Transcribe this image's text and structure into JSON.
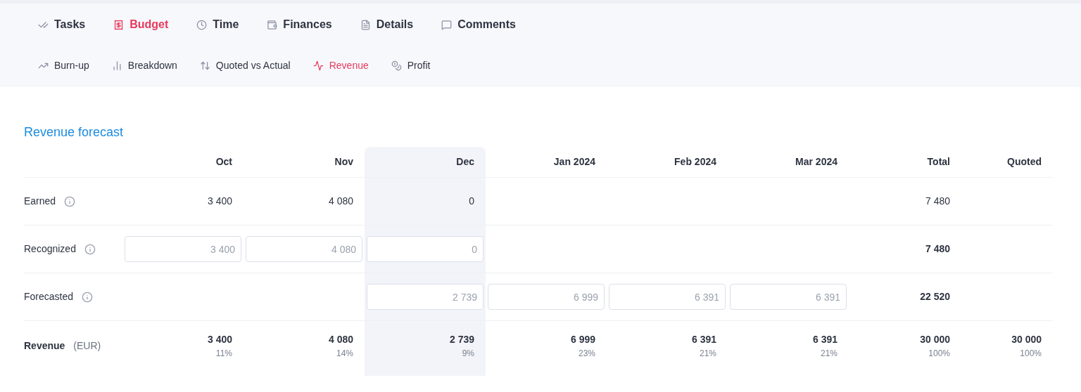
{
  "tabs": [
    {
      "label": "Tasks",
      "selected": false
    },
    {
      "label": "Budget",
      "selected": true
    },
    {
      "label": "Time",
      "selected": false
    },
    {
      "label": "Finances",
      "selected": false
    },
    {
      "label": "Details",
      "selected": false
    },
    {
      "label": "Comments",
      "selected": false
    }
  ],
  "subtabs": [
    {
      "label": "Burn-up",
      "selected": false
    },
    {
      "label": "Breakdown",
      "selected": false
    },
    {
      "label": "Quoted vs Actual",
      "selected": false
    },
    {
      "label": "Revenue",
      "selected": true
    },
    {
      "label": "Profit",
      "selected": false
    }
  ],
  "title": "Revenue forecast",
  "table": {
    "columns": [
      {
        "label": "Oct",
        "highlighted": false
      },
      {
        "label": "Nov",
        "highlighted": false
      },
      {
        "label": "Dec",
        "highlighted": true
      },
      {
        "label": "Jan 2024",
        "highlighted": false
      },
      {
        "label": "Feb 2024",
        "highlighted": false
      },
      {
        "label": "Mar 2024",
        "highlighted": false
      },
      {
        "label": "Total",
        "highlighted": false
      },
      {
        "label": "Quoted",
        "highlighted": false
      }
    ],
    "rows": [
      {
        "label": "Earned",
        "info": true,
        "bold": false,
        "cells": [
          {
            "kind": "value",
            "text": "3 400"
          },
          {
            "kind": "value",
            "text": "4 080"
          },
          {
            "kind": "value",
            "text": "0"
          },
          {
            "kind": "empty"
          },
          {
            "kind": "empty"
          },
          {
            "kind": "empty"
          },
          {
            "kind": "value",
            "text": "7 480"
          },
          {
            "kind": "empty"
          }
        ]
      },
      {
        "label": "Recognized",
        "info": true,
        "bold": false,
        "cells": [
          {
            "kind": "input",
            "placeholder": "3 400"
          },
          {
            "kind": "input",
            "placeholder": "4 080"
          },
          {
            "kind": "input",
            "placeholder": "0"
          },
          {
            "kind": "empty"
          },
          {
            "kind": "empty"
          },
          {
            "kind": "empty"
          },
          {
            "kind": "strong",
            "text": "7 480"
          },
          {
            "kind": "empty"
          }
        ]
      },
      {
        "label": "Forecasted",
        "info": true,
        "bold": false,
        "cells": [
          {
            "kind": "empty"
          },
          {
            "kind": "empty"
          },
          {
            "kind": "input",
            "placeholder": "2 739"
          },
          {
            "kind": "input",
            "placeholder": "6 999"
          },
          {
            "kind": "input",
            "placeholder": "6 391"
          },
          {
            "kind": "input",
            "placeholder": "6 391"
          },
          {
            "kind": "strong",
            "text": "22 520"
          },
          {
            "kind": "empty"
          }
        ]
      },
      {
        "label": "Revenue",
        "unit": "(EUR)",
        "info": false,
        "bold": true,
        "cells": [
          {
            "kind": "strong",
            "text": "3 400",
            "share": "11%"
          },
          {
            "kind": "strong",
            "text": "4 080",
            "share": "14%"
          },
          {
            "kind": "strong",
            "text": "2 739",
            "share": "9%"
          },
          {
            "kind": "strong",
            "text": "6 999",
            "share": "23%"
          },
          {
            "kind": "strong",
            "text": "6 391",
            "share": "21%"
          },
          {
            "kind": "strong",
            "text": "6 391",
            "share": "21%"
          },
          {
            "kind": "strong",
            "text": "30 000",
            "share": "100%"
          },
          {
            "kind": "strong",
            "text": "30 000",
            "share": "100%"
          }
        ]
      }
    ]
  }
}
